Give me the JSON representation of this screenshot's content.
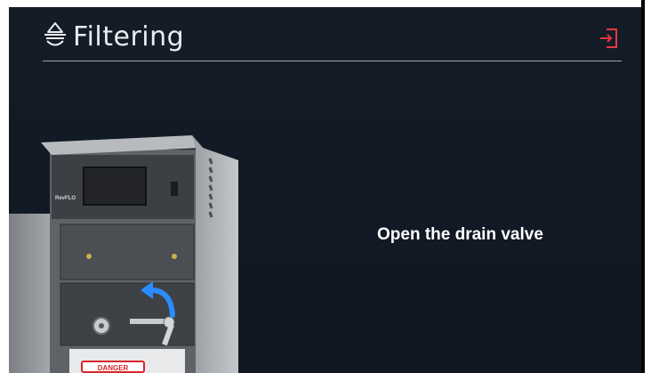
{
  "header": {
    "title": "Filtering",
    "icon": "droplet-filter-icon",
    "exit_icon": "exit-icon"
  },
  "instruction": {
    "text": "Open the drain valve"
  },
  "illustration": {
    "brand_label": "RevFLO",
    "warning_label": "DANGER",
    "arrow_icon": "curved-arrow-icon"
  },
  "colors": {
    "background": "#121a26",
    "accent_exit": "#e8383d",
    "arrow_blue": "#2a8cff",
    "danger_red": "#d8262c"
  }
}
